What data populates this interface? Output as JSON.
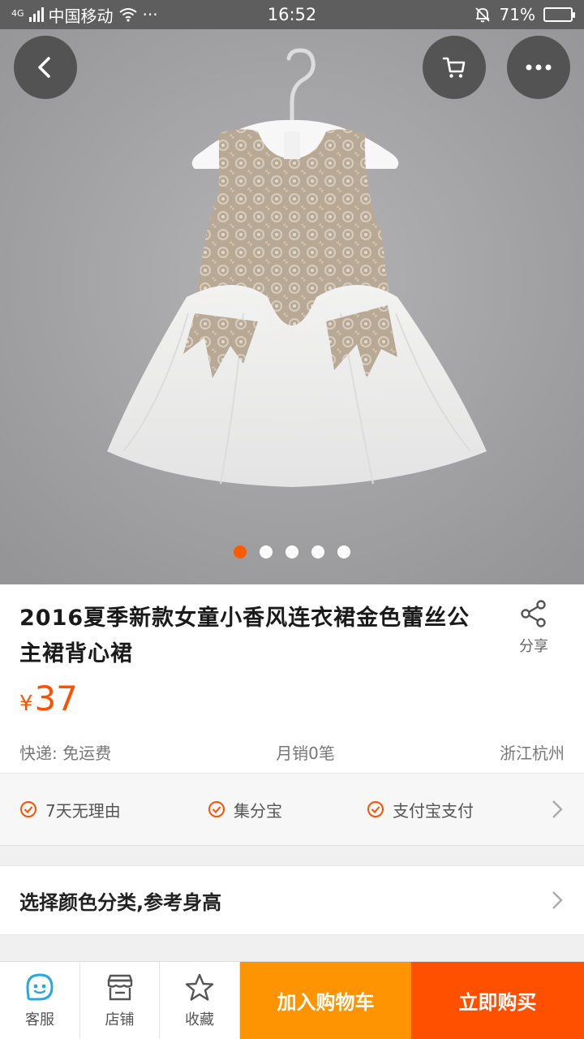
{
  "status_bar": {
    "network": "4G",
    "carrier": "中国移动",
    "extra": "···",
    "time": "16:52",
    "battery_text": "71%",
    "battery_level": 0.71
  },
  "gallery": {
    "image_count": 5,
    "active_index": 0,
    "back_icon": "chevron-left-icon",
    "cart_icon": "cart-icon",
    "more_icon": "more-icon"
  },
  "product": {
    "title": "2016夏季新款女童小香风连衣裙金色蕾丝公主裙背心裙",
    "price_symbol": "¥",
    "price": "37",
    "share_label": "分享",
    "shipping": "快递: 免运费",
    "monthly_sales": "月销0笔",
    "location": "浙江杭州"
  },
  "guarantees": [
    "7天无理由",
    "集分宝",
    "支付宝支付"
  ],
  "spec": {
    "label": "选择颜色分类,参考身高"
  },
  "bottom_bar": {
    "service_label": "客服",
    "store_label": "店铺",
    "favorite_label": "收藏",
    "add_to_cart_label": "加入购物车",
    "buy_now_label": "立即购买"
  },
  "colors": {
    "accent": "#ff5000",
    "cart_button": "#ff9402",
    "service_icon": "#29a8e0"
  }
}
